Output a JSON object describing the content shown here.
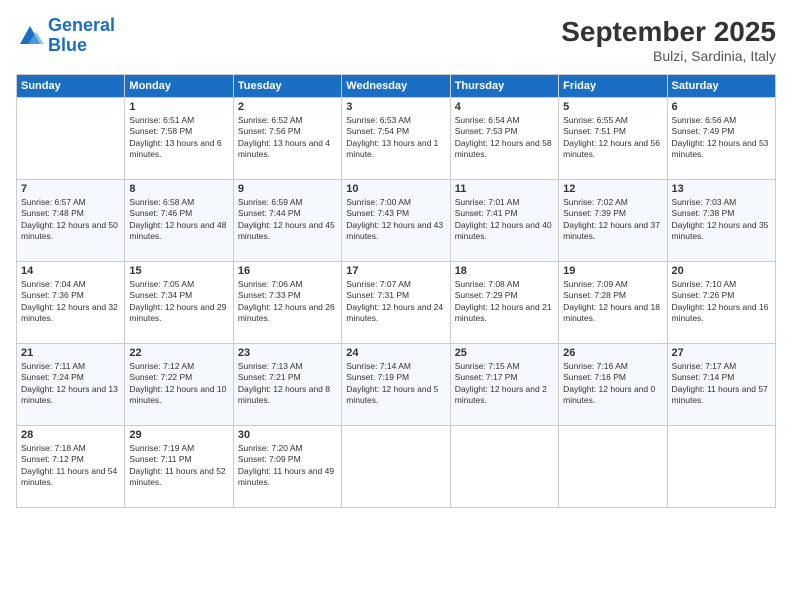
{
  "header": {
    "logo_general": "General",
    "logo_blue": "Blue",
    "month_title": "September 2025",
    "location": "Bulzi, Sardinia, Italy"
  },
  "days_of_week": [
    "Sunday",
    "Monday",
    "Tuesday",
    "Wednesday",
    "Thursday",
    "Friday",
    "Saturday"
  ],
  "weeks": [
    [
      {
        "num": "",
        "sunrise": "",
        "sunset": "",
        "daylight": ""
      },
      {
        "num": "1",
        "sunrise": "Sunrise: 6:51 AM",
        "sunset": "Sunset: 7:58 PM",
        "daylight": "Daylight: 13 hours and 6 minutes."
      },
      {
        "num": "2",
        "sunrise": "Sunrise: 6:52 AM",
        "sunset": "Sunset: 7:56 PM",
        "daylight": "Daylight: 13 hours and 4 minutes."
      },
      {
        "num": "3",
        "sunrise": "Sunrise: 6:53 AM",
        "sunset": "Sunset: 7:54 PM",
        "daylight": "Daylight: 13 hours and 1 minute."
      },
      {
        "num": "4",
        "sunrise": "Sunrise: 6:54 AM",
        "sunset": "Sunset: 7:53 PM",
        "daylight": "Daylight: 12 hours and 58 minutes."
      },
      {
        "num": "5",
        "sunrise": "Sunrise: 6:55 AM",
        "sunset": "Sunset: 7:51 PM",
        "daylight": "Daylight: 12 hours and 56 minutes."
      },
      {
        "num": "6",
        "sunrise": "Sunrise: 6:56 AM",
        "sunset": "Sunset: 7:49 PM",
        "daylight": "Daylight: 12 hours and 53 minutes."
      }
    ],
    [
      {
        "num": "7",
        "sunrise": "Sunrise: 6:57 AM",
        "sunset": "Sunset: 7:48 PM",
        "daylight": "Daylight: 12 hours and 50 minutes."
      },
      {
        "num": "8",
        "sunrise": "Sunrise: 6:58 AM",
        "sunset": "Sunset: 7:46 PM",
        "daylight": "Daylight: 12 hours and 48 minutes."
      },
      {
        "num": "9",
        "sunrise": "Sunrise: 6:59 AM",
        "sunset": "Sunset: 7:44 PM",
        "daylight": "Daylight: 12 hours and 45 minutes."
      },
      {
        "num": "10",
        "sunrise": "Sunrise: 7:00 AM",
        "sunset": "Sunset: 7:43 PM",
        "daylight": "Daylight: 12 hours and 43 minutes."
      },
      {
        "num": "11",
        "sunrise": "Sunrise: 7:01 AM",
        "sunset": "Sunset: 7:41 PM",
        "daylight": "Daylight: 12 hours and 40 minutes."
      },
      {
        "num": "12",
        "sunrise": "Sunrise: 7:02 AM",
        "sunset": "Sunset: 7:39 PM",
        "daylight": "Daylight: 12 hours and 37 minutes."
      },
      {
        "num": "13",
        "sunrise": "Sunrise: 7:03 AM",
        "sunset": "Sunset: 7:38 PM",
        "daylight": "Daylight: 12 hours and 35 minutes."
      }
    ],
    [
      {
        "num": "14",
        "sunrise": "Sunrise: 7:04 AM",
        "sunset": "Sunset: 7:36 PM",
        "daylight": "Daylight: 12 hours and 32 minutes."
      },
      {
        "num": "15",
        "sunrise": "Sunrise: 7:05 AM",
        "sunset": "Sunset: 7:34 PM",
        "daylight": "Daylight: 12 hours and 29 minutes."
      },
      {
        "num": "16",
        "sunrise": "Sunrise: 7:06 AM",
        "sunset": "Sunset: 7:33 PM",
        "daylight": "Daylight: 12 hours and 26 minutes."
      },
      {
        "num": "17",
        "sunrise": "Sunrise: 7:07 AM",
        "sunset": "Sunset: 7:31 PM",
        "daylight": "Daylight: 12 hours and 24 minutes."
      },
      {
        "num": "18",
        "sunrise": "Sunrise: 7:08 AM",
        "sunset": "Sunset: 7:29 PM",
        "daylight": "Daylight: 12 hours and 21 minutes."
      },
      {
        "num": "19",
        "sunrise": "Sunrise: 7:09 AM",
        "sunset": "Sunset: 7:28 PM",
        "daylight": "Daylight: 12 hours and 18 minutes."
      },
      {
        "num": "20",
        "sunrise": "Sunrise: 7:10 AM",
        "sunset": "Sunset: 7:26 PM",
        "daylight": "Daylight: 12 hours and 16 minutes."
      }
    ],
    [
      {
        "num": "21",
        "sunrise": "Sunrise: 7:11 AM",
        "sunset": "Sunset: 7:24 PM",
        "daylight": "Daylight: 12 hours and 13 minutes."
      },
      {
        "num": "22",
        "sunrise": "Sunrise: 7:12 AM",
        "sunset": "Sunset: 7:22 PM",
        "daylight": "Daylight: 12 hours and 10 minutes."
      },
      {
        "num": "23",
        "sunrise": "Sunrise: 7:13 AM",
        "sunset": "Sunset: 7:21 PM",
        "daylight": "Daylight: 12 hours and 8 minutes."
      },
      {
        "num": "24",
        "sunrise": "Sunrise: 7:14 AM",
        "sunset": "Sunset: 7:19 PM",
        "daylight": "Daylight: 12 hours and 5 minutes."
      },
      {
        "num": "25",
        "sunrise": "Sunrise: 7:15 AM",
        "sunset": "Sunset: 7:17 PM",
        "daylight": "Daylight: 12 hours and 2 minutes."
      },
      {
        "num": "26",
        "sunrise": "Sunrise: 7:16 AM",
        "sunset": "Sunset: 7:16 PM",
        "daylight": "Daylight: 12 hours and 0 minutes."
      },
      {
        "num": "27",
        "sunrise": "Sunrise: 7:17 AM",
        "sunset": "Sunset: 7:14 PM",
        "daylight": "Daylight: 11 hours and 57 minutes."
      }
    ],
    [
      {
        "num": "28",
        "sunrise": "Sunrise: 7:18 AM",
        "sunset": "Sunset: 7:12 PM",
        "daylight": "Daylight: 11 hours and 54 minutes."
      },
      {
        "num": "29",
        "sunrise": "Sunrise: 7:19 AM",
        "sunset": "Sunset: 7:11 PM",
        "daylight": "Daylight: 11 hours and 52 minutes."
      },
      {
        "num": "30",
        "sunrise": "Sunrise: 7:20 AM",
        "sunset": "Sunset: 7:09 PM",
        "daylight": "Daylight: 11 hours and 49 minutes."
      },
      {
        "num": "",
        "sunrise": "",
        "sunset": "",
        "daylight": ""
      },
      {
        "num": "",
        "sunrise": "",
        "sunset": "",
        "daylight": ""
      },
      {
        "num": "",
        "sunrise": "",
        "sunset": "",
        "daylight": ""
      },
      {
        "num": "",
        "sunrise": "",
        "sunset": "",
        "daylight": ""
      }
    ]
  ]
}
